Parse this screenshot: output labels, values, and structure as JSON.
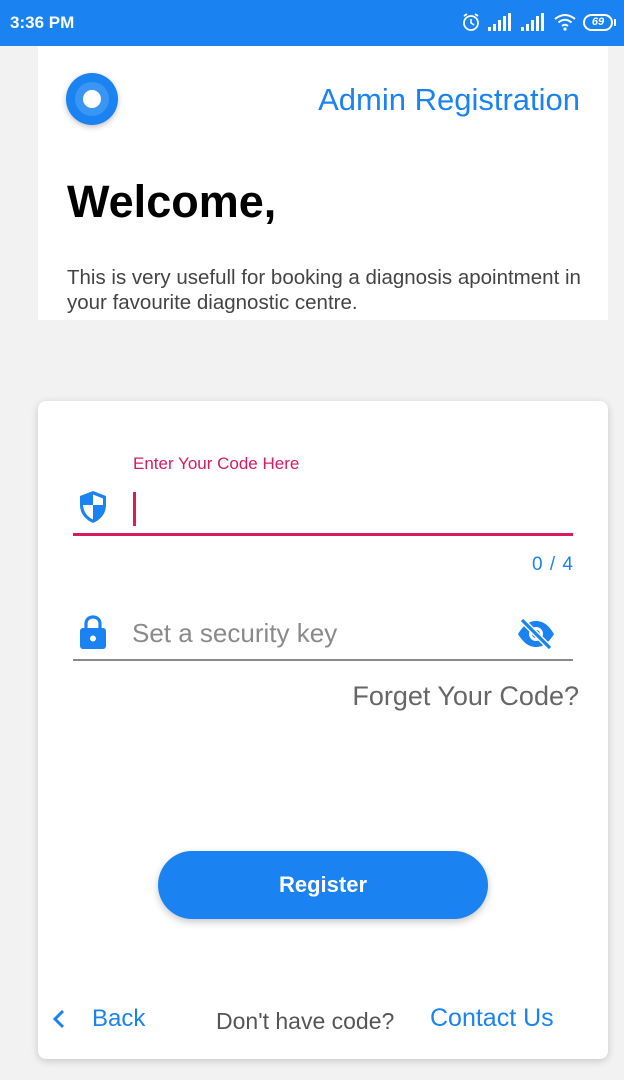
{
  "status_bar": {
    "time": "3:36 PM",
    "battery": "69"
  },
  "header": {
    "title": "Admin Registration",
    "welcome": "Welcome,",
    "description": "This is very usefull for booking a diagnosis apointment in your favourite diagnostic centre."
  },
  "form": {
    "code_label": "Enter Your Code Here",
    "code_value": "",
    "code_counter": "0 / 4",
    "security_key_placeholder": "Set a security key",
    "security_key_value": "",
    "forget_link": "Forget Your Code?",
    "register_label": "Register"
  },
  "footer": {
    "back_label": "Back",
    "no_code_text": "Don't have code?",
    "contact_label": "Contact Us"
  },
  "colors": {
    "primary": "#1a83f1",
    "accent_focus": "#d81b60",
    "background": "#f2f2f2"
  },
  "icons": {
    "logo": "target-logo-icon",
    "code_field": "shield-icon",
    "security_field": "lock-icon",
    "visibility_toggle": "eye-off-icon",
    "back": "chevron-left-icon"
  }
}
